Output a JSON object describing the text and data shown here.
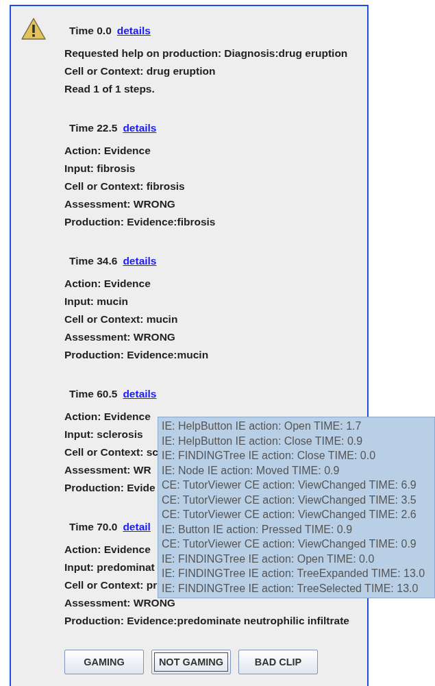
{
  "sections": [
    {
      "time": "Time 0.0",
      "link": "details",
      "lines": [
        "Requested help on production: Diagnosis:drug eruption",
        "Cell or Context: drug eruption",
        "Read 1 of 1 steps."
      ]
    },
    {
      "time": "Time 22.5",
      "link": "details",
      "lines": [
        "Action: Evidence",
        "Input: fibrosis",
        "Cell or Context: fibrosis",
        "Assessment: WRONG",
        "Production: Evidence:fibrosis"
      ]
    },
    {
      "time": "Time 34.6",
      "link": "details",
      "lines": [
        "Action: Evidence",
        "Input: mucin",
        "Cell or Context: mucin",
        "Assessment: WRONG",
        "Production: Evidence:mucin"
      ]
    },
    {
      "time": "Time 60.5",
      "link": "details",
      "lines": [
        "Action: Evidence",
        "Input: sclerosis",
        "Cell or Context: sc",
        "Assessment: WR",
        "Production: Evide"
      ]
    },
    {
      "time": "Time 70.0",
      "link": "detail",
      "lines": [
        "Action: Evidence",
        "Input: predominat",
        "Cell or Context: pr",
        "Assessment: WRONG",
        "Production: Evidence:predominate neutrophilic infiltrate"
      ]
    }
  ],
  "tooltip": [
    "IE: HelpButton IE action: Open TIME: 1.7",
    "IE: HelpButton IE action: Close TIME: 0.9",
    "IE: FINDINGTree IE action: Close TIME: 0.0",
    "IE: Node IE action: Moved TIME: 0.9",
    "CE: TutorViewer CE action: ViewChanged TIME: 6.9",
    "CE: TutorViewer CE action: ViewChanged TIME: 3.5",
    "CE: TutorViewer CE action: ViewChanged TIME: 2.6",
    "IE: Button IE action: Pressed TIME: 0.9",
    "CE: TutorViewer CE action: ViewChanged TIME: 0.9",
    "IE: FINDINGTree IE action: Open TIME: 0.0",
    "IE: FINDINGTree IE action: TreeExpanded TIME: 13.0",
    "IE: FINDINGTree IE action: TreeSelected TIME: 13.0"
  ],
  "buttons": [
    {
      "label": "GAMING",
      "focused": false
    },
    {
      "label": "NOT GAMING",
      "focused": true
    },
    {
      "label": "BAD CLIP",
      "focused": false
    }
  ]
}
